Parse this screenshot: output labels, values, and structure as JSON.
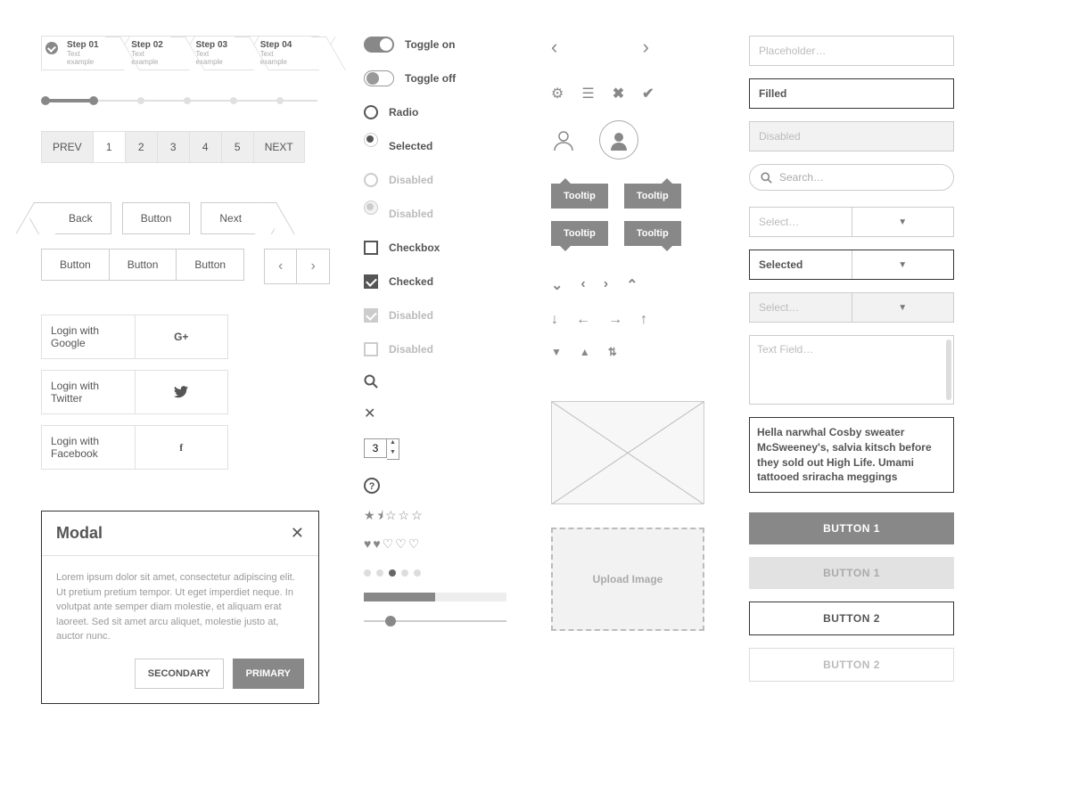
{
  "steps": [
    {
      "title": "Step 01",
      "sub": "Text example"
    },
    {
      "title": "Step 02",
      "sub": "Text example"
    },
    {
      "title": "Step 03",
      "sub": "Text example"
    },
    {
      "title": "Step 04",
      "sub": "Text example"
    }
  ],
  "pagination": {
    "prev": "PREV",
    "next": "NEXT",
    "pages": [
      "1",
      "2",
      "3",
      "4",
      "5"
    ],
    "current": 0
  },
  "nav": {
    "back": "Back",
    "button": "Button",
    "next": "Next"
  },
  "group": [
    "Button",
    "Button",
    "Button"
  ],
  "social": {
    "google": "Login with Google",
    "twitter": "Login with Twitter",
    "facebook": "Login with Facebook",
    "g": "G+",
    "t": "",
    "f": "f"
  },
  "modal": {
    "title": "Modal",
    "body": "Lorem ipsum dolor sit amet, consectetur adipiscing elit. Ut pretium pretium tempor. Ut eget imperdiet neque. In volutpat ante semper diam molestie, et aliquam erat laoreet. Sed sit amet arcu aliquet, molestie justo at, auctor nunc.",
    "secondary": "SECONDARY",
    "primary": "PRIMARY"
  },
  "controls": {
    "toggle_on": "Toggle on",
    "toggle_off": "Toggle off",
    "radio": "Radio",
    "selected": "Selected",
    "disabled": "Disabled",
    "checkbox": "Checkbox",
    "checked": "Checked"
  },
  "stepper_value": "3",
  "tooltip": "Tooltip",
  "upload": "Upload Image",
  "inputs": {
    "placeholder": "Placeholder…",
    "filled": "Filled",
    "disabled": "Disabled",
    "search": "Search…",
    "select": "Select…",
    "selected": "Selected",
    "textfield": "Text Field…",
    "para": "Hella narwhal Cosby sweater McSweeney's, salvia kitsch before they sold out High Life. Umami tattooed sriracha meggings"
  },
  "buttons": {
    "b1": "BUTTON 1",
    "b2": "BUTTON 2"
  }
}
